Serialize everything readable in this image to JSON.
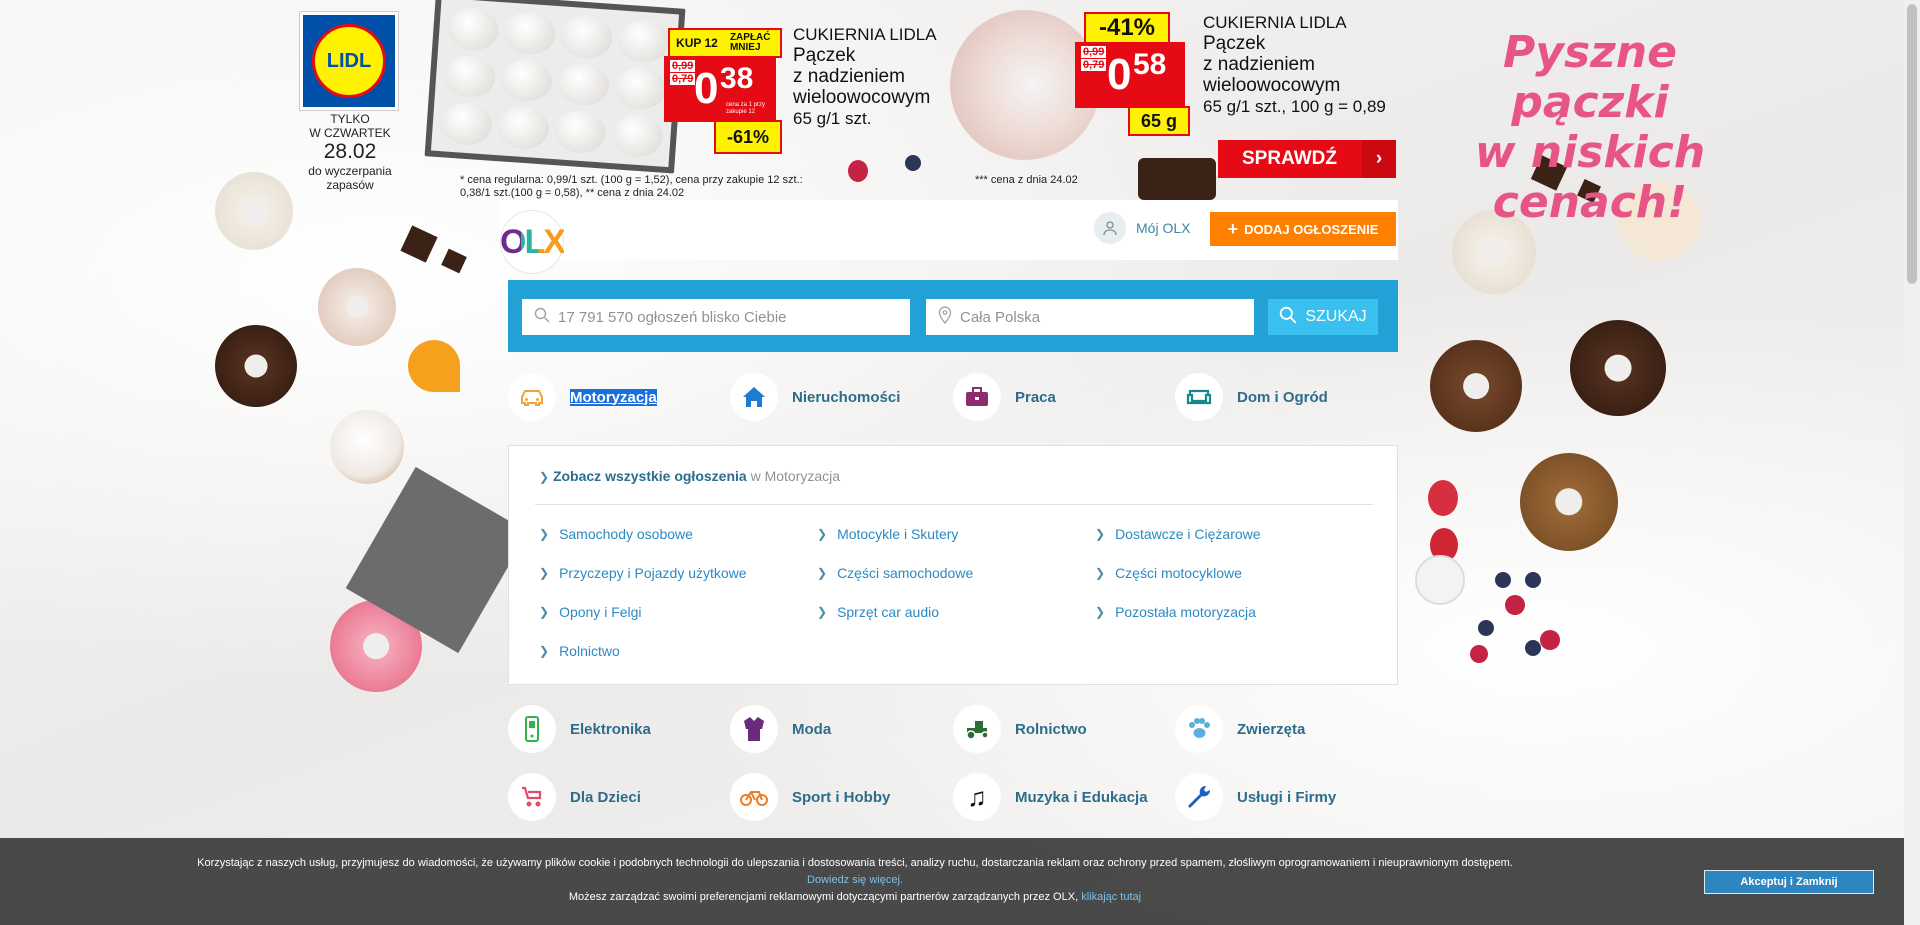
{
  "ad": {
    "lidl_logo": "LIDL",
    "date_line1": "TYLKO",
    "date_line2": "W CZWARTEK",
    "date": "28.02",
    "date_line3": "do wyczerpania",
    "date_line4": "zapasów",
    "offer1": {
      "badge_kup": "KUP 12",
      "badge_zaplac": "ZAPŁAĆ MNIEJ",
      "old_price": "0,99",
      "old_price2": "0,79",
      "price_main": "0",
      "price_decimal": "38",
      "price_note": "cena za 1 przy zakupie 12",
      "discount": "-61%",
      "brand": "CUKIERNIA LIDLA",
      "name1": "Pączek",
      "name2": "z nadzieniem",
      "name3": "wieloowocowym",
      "detail": "65 g/1 szt.",
      "footnote1": "* cena regularna: 0,99/1 szt. (100 g = 1,52), cena przy zakupie 12 szt.:",
      "footnote2": "0,38/1 szt.(100 g = 0,58), ** cena z dnia 24.02"
    },
    "offer2": {
      "discount": "-41%",
      "old_price": "0,99",
      "old_price2": "0,79",
      "price_main": "0",
      "price_decimal": "58",
      "weight": "65 g",
      "brand": "CUKIERNIA LIDLA",
      "name1": "Pączek",
      "name2": "z nadzieniem",
      "name3": "wieloowocowym",
      "detail": "65 g/1 szt., 100 g = 0,89",
      "footnote": "*** cena z dnia 24.02"
    },
    "slogan1": "Pyszne pączki",
    "slogan2": "w niskich cenach!",
    "cta": "SPRAWDŹ"
  },
  "header": {
    "logo": "OLX",
    "my_olx": "Mój OLX",
    "add_button": "DODAJ OGŁOSZENIE"
  },
  "search": {
    "query_placeholder": "17 791 570 ogłoszeń blisko Ciebie",
    "location_placeholder": "Cała Polska",
    "button": "SZUKAJ"
  },
  "categories_top": [
    {
      "label": "Motoryzacja",
      "icon": "car-icon",
      "color": "#f0a43a"
    },
    {
      "label": "Nieruchomości",
      "icon": "house-icon",
      "color": "#1d7bd2"
    },
    {
      "label": "Praca",
      "icon": "briefcase-icon",
      "color": "#8d2b6e"
    },
    {
      "label": "Dom i Ogród",
      "icon": "sofa-icon",
      "color": "#13898c"
    }
  ],
  "subcategories": {
    "see_all_bold": "Zobacz wszystkie ogłoszenia",
    "see_all_rest": " w Motoryzacja",
    "items": [
      "Samochody osobowe",
      "Motocykle i Skutery",
      "Dostawcze i Ciężarowe",
      "Przyczepy i Pojazdy użytkowe",
      "Części samochodowe",
      "Części motocyklowe",
      "Opony i Felgi",
      "Sprzęt car audio",
      "Pozostała motoryzacja",
      "Rolnictwo"
    ]
  },
  "categories_more": [
    {
      "label": "Elektronika",
      "icon": "phone-icon",
      "color": "#2fb34a"
    },
    {
      "label": "Moda",
      "icon": "coat-icon",
      "color": "#6b2a7a"
    },
    {
      "label": "Rolnictwo",
      "icon": "tractor-icon",
      "color": "#2b6d35"
    },
    {
      "label": "Zwierzęta",
      "icon": "paw-icon",
      "color": "#5aaee0"
    },
    {
      "label": "Dla Dzieci",
      "icon": "stroller-icon",
      "color": "#e24b6a"
    },
    {
      "label": "Sport i Hobby",
      "icon": "bike-icon",
      "color": "#e87e2a"
    },
    {
      "label": "Muzyka i Edukacja",
      "icon": "music-icon",
      "color": "#111111"
    },
    {
      "label": "Usługi i Firmy",
      "icon": "wrench-icon",
      "color": "#1e5fc2"
    }
  ],
  "cookie": {
    "line1": "Korzystając z naszych usług, przyjmujesz do wiadomości, że używamy plików cookie i podobnych technologii do ulepszania i dostosowania treści, analizy ruchu, dostarczania reklam oraz ochrony przed spamem, złośliwym oprogramowaniem i nieuprawnionym dostępem.",
    "learn_more": "Dowiedz się więcej.",
    "line3": "Możesz zarządzać swoimi preferencjami reklamowymi dotyczącymi partnerów zarządzanych przez OLX,",
    "link": "klikając tutaj",
    "accept": "Akceptuj i Zamknij"
  }
}
